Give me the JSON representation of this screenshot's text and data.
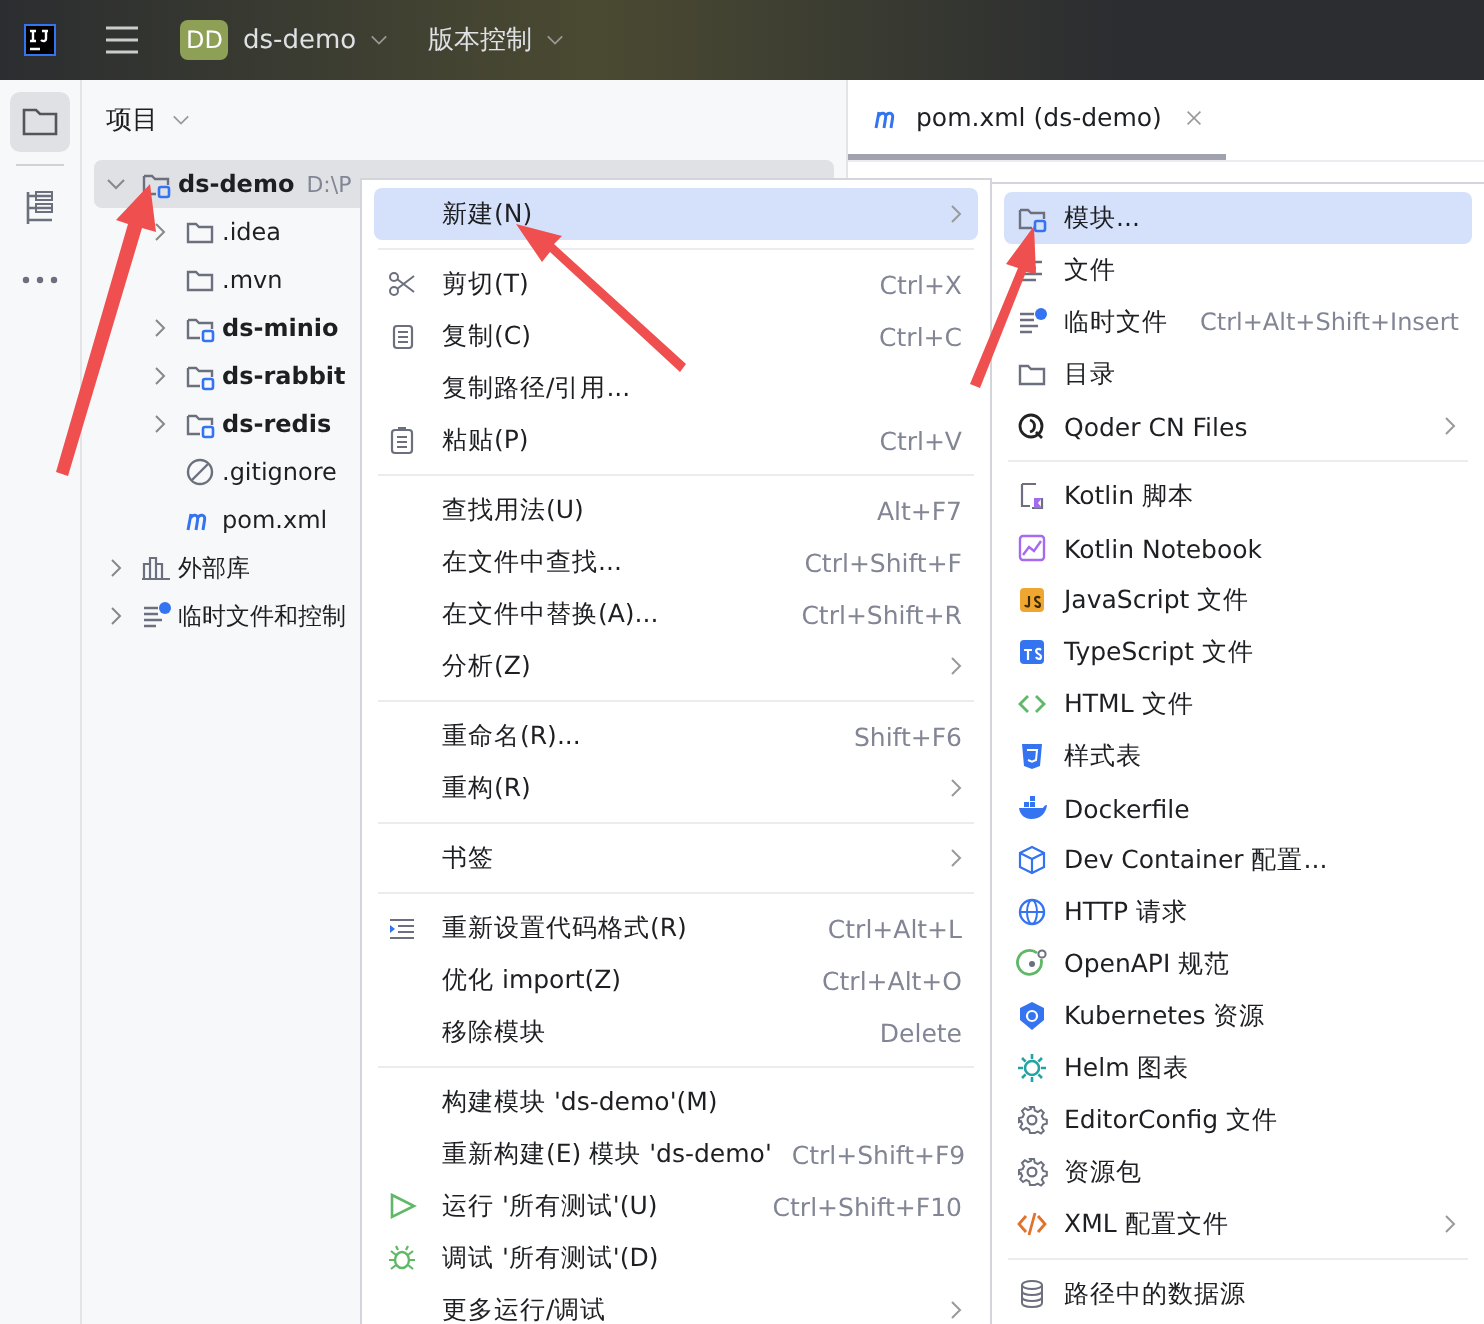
{
  "title_bar": {
    "project_badge": "DD",
    "project": "ds-demo",
    "vcs": "版本控制"
  },
  "project_panel": {
    "title": "项目",
    "tree": [
      {
        "label": "ds-demo",
        "path": "D:\\P",
        "kind": "module",
        "bold": true,
        "expanded": true,
        "selected": true,
        "children": [
          {
            "label": ".idea",
            "kind": "folder",
            "bold": false,
            "expanded": false,
            "selected": false,
            "expandable": true
          },
          {
            "label": ".mvn",
            "kind": "folder",
            "bold": false,
            "selected": false,
            "expandable": false
          },
          {
            "label": "ds-minio",
            "kind": "module",
            "bold": true,
            "expanded": false,
            "selected": false,
            "expandable": true
          },
          {
            "label": "ds-rabbit",
            "kind": "module",
            "bold": true,
            "expanded": false,
            "selected": false,
            "expandable": true
          },
          {
            "label": "ds-redis",
            "kind": "module",
            "bold": true,
            "expanded": false,
            "selected": false,
            "expandable": true
          },
          {
            "label": ".gitignore",
            "kind": "ignore",
            "bold": false,
            "selected": false,
            "expandable": false
          },
          {
            "label": "pom.xml",
            "kind": "maven",
            "bold": false,
            "selected": false,
            "expandable": false
          }
        ]
      },
      {
        "label": "外部库",
        "kind": "library",
        "bold": false,
        "expanded": false,
        "selected": false,
        "expandable": true
      },
      {
        "label": "临时文件和控制",
        "kind": "scratch",
        "bold": false,
        "expanded": false,
        "selected": false,
        "expandable": true
      }
    ]
  },
  "editor_tab": {
    "title": "pom.xml (ds-demo)",
    "selected": true
  },
  "context_menu": [
    {
      "kind": "plain",
      "label": "新建(N)",
      "submenu": true,
      "selected": true
    },
    {
      "kind": "separator"
    },
    {
      "kind": "scissors",
      "label": "剪切(T)",
      "shortcut": "Ctrl+X",
      "submenu": false,
      "selected": false
    },
    {
      "kind": "copy",
      "label": "复制(C)",
      "shortcut": "Ctrl+C",
      "submenu": false,
      "selected": false
    },
    {
      "kind": "plain",
      "label": "复制路径/引用...",
      "submenu": false,
      "selected": false
    },
    {
      "kind": "paste",
      "label": "粘贴(P)",
      "shortcut": "Ctrl+V",
      "submenu": false,
      "selected": false
    },
    {
      "kind": "separator"
    },
    {
      "kind": "plain",
      "label": "查找用法(U)",
      "shortcut": "Alt+F7",
      "submenu": false,
      "selected": false
    },
    {
      "kind": "plain",
      "label": "在文件中查找...",
      "shortcut": "Ctrl+Shift+F",
      "submenu": false,
      "selected": false
    },
    {
      "kind": "plain",
      "label": "在文件中替换(A)...",
      "shortcut": "Ctrl+Shift+R",
      "submenu": false,
      "selected": false
    },
    {
      "kind": "plain",
      "label": "分析(Z)",
      "submenu": true,
      "selected": false
    },
    {
      "kind": "separator"
    },
    {
      "kind": "plain",
      "label": "重命名(R)...",
      "shortcut": "Shift+F6",
      "submenu": false,
      "selected": false
    },
    {
      "kind": "plain",
      "label": "重构(R)",
      "submenu": true,
      "selected": false
    },
    {
      "kind": "separator"
    },
    {
      "kind": "plain",
      "label": "书签",
      "submenu": true,
      "selected": false
    },
    {
      "kind": "separator"
    },
    {
      "kind": "reformat",
      "label": "重新设置代码格式(R)",
      "shortcut": "Ctrl+Alt+L",
      "submenu": false,
      "selected": false
    },
    {
      "kind": "plain",
      "label": "优化 import(Z)",
      "shortcut": "Ctrl+Alt+O",
      "submenu": false,
      "selected": false
    },
    {
      "kind": "plain",
      "label": "移除模块",
      "shortcut": "Delete",
      "submenu": false,
      "selected": false
    },
    {
      "kind": "separator"
    },
    {
      "kind": "plain",
      "label": "构建模块 'ds-demo'(M)",
      "submenu": false,
      "selected": false
    },
    {
      "kind": "plain",
      "label": "重新构建(E) 模块 'ds-demo'",
      "shortcut": "Ctrl+Shift+F9",
      "submenu": false,
      "selected": false
    },
    {
      "kind": "run",
      "label": "运行 '所有测试'(U)",
      "shortcut": "Ctrl+Shift+F10",
      "submenu": false,
      "selected": false
    },
    {
      "kind": "debug",
      "label": "调试 '所有测试'(D)",
      "submenu": false,
      "selected": false
    },
    {
      "kind": "plain",
      "label": "更多运行/调试",
      "submenu": true,
      "selected": false
    }
  ],
  "new_submenu": [
    {
      "kind": "module",
      "label": "模块...",
      "submenu": false,
      "selected": true
    },
    {
      "kind": "file",
      "label": "文件",
      "submenu": false,
      "selected": false
    },
    {
      "kind": "scratch",
      "label": "临时文件",
      "shortcut": "Ctrl+Alt+Shift+Insert",
      "submenu": false,
      "selected": false
    },
    {
      "kind": "folder",
      "label": "目录",
      "submenu": false,
      "selected": false
    },
    {
      "kind": "qoder",
      "label": "Qoder CN Files",
      "submenu": true,
      "selected": false
    },
    {
      "kind": "separator"
    },
    {
      "kind": "kotlin",
      "label": "Kotlin 脚本",
      "submenu": false,
      "selected": false
    },
    {
      "kind": "notebook",
      "label": "Kotlin Notebook",
      "submenu": false,
      "selected": false
    },
    {
      "kind": "js",
      "label": "JavaScript 文件",
      "submenu": false,
      "selected": false
    },
    {
      "kind": "ts",
      "label": "TypeScript 文件",
      "submenu": false,
      "selected": false
    },
    {
      "kind": "html",
      "label": "HTML 文件",
      "submenu": false,
      "selected": false
    },
    {
      "kind": "css",
      "label": "样式表",
      "submenu": false,
      "selected": false
    },
    {
      "kind": "docker",
      "label": "Dockerfile",
      "submenu": false,
      "selected": false
    },
    {
      "kind": "cube",
      "label": "Dev Container 配置...",
      "submenu": false,
      "selected": false
    },
    {
      "kind": "globe",
      "label": "HTTP 请求",
      "submenu": false,
      "selected": false
    },
    {
      "kind": "openapi",
      "label": "OpenAPI 规范",
      "submenu": false,
      "selected": false
    },
    {
      "kind": "k8s",
      "label": "Kubernetes 资源",
      "submenu": false,
      "selected": false
    },
    {
      "kind": "helm",
      "label": "Helm 图表",
      "submenu": false,
      "selected": false
    },
    {
      "kind": "gear",
      "label": "EditorConfig 文件",
      "submenu": false,
      "selected": false
    },
    {
      "kind": "gear",
      "label": "资源包",
      "submenu": false,
      "selected": false
    },
    {
      "kind": "xml",
      "label": "XML 配置文件",
      "submenu": true,
      "selected": false
    },
    {
      "kind": "separator"
    },
    {
      "kind": "database",
      "label": "路径中的数据源",
      "submenu": false,
      "selected": false
    }
  ]
}
